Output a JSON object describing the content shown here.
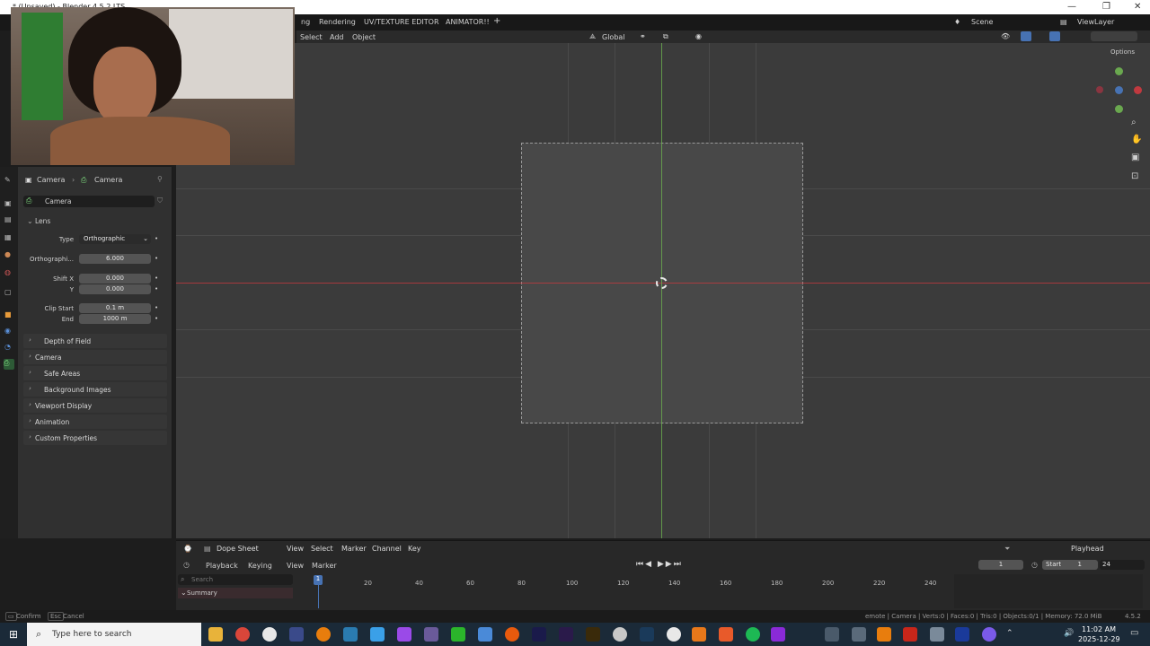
{
  "window": {
    "title": "* (Unsaved) - Blender 4.5.2 LTS"
  },
  "topbar": {
    "workspaces": [
      "Rendering",
      "UV/TEXTURE EDITOR",
      "ANIMATOR!!",
      "+"
    ],
    "scene": "Scene",
    "view_layer": "ViewLayer"
  },
  "viewport_header": {
    "menu": [
      "Select",
      "Add",
      "Object"
    ],
    "orientation": "Global",
    "options": "Options"
  },
  "properties": {
    "breadcrumb": [
      "Camera",
      "Camera"
    ],
    "datablock": "Camera",
    "lens_label": "Lens",
    "fields": [
      {
        "label": "Type",
        "value": "Orthographic"
      },
      {
        "label": "Orthographi...",
        "value": "6.000"
      },
      {
        "label": "Shift X",
        "value": "0.000"
      },
      {
        "label": "Y",
        "value": "0.000"
      },
      {
        "label": "Clip Start",
        "value": "0.1 m"
      },
      {
        "label": "End",
        "value": "1000 m"
      }
    ],
    "panels": [
      "Depth of Field",
      "Camera",
      "Safe Areas",
      "Background Images",
      "Viewport Display",
      "Animation",
      "Custom Properties"
    ]
  },
  "dopesheet": {
    "editor": "Dope Sheet",
    "menu": [
      "View",
      "Select",
      "Marker",
      "Channel",
      "Key"
    ],
    "playhead": "Playhead",
    "timeline_menu": [
      "Playback",
      "Keying",
      "View",
      "Marker"
    ],
    "current_frame": "1",
    "start_label": "Start",
    "start": "1",
    "end": "24",
    "search_placeholder": "Search",
    "summary": "Summary",
    "ticks": [
      "1",
      "20",
      "40",
      "60",
      "80",
      "100",
      "120",
      "140",
      "160",
      "180",
      "200",
      "220",
      "240"
    ]
  },
  "status": {
    "left": [
      "Confirm",
      "Esc",
      "Cancel"
    ],
    "right": "emote | Camera | Verts:0 | Faces:0 | Tris:0 | Objects:0/1 | Memory: 72.0 MiB",
    "version": "4.5.2"
  },
  "taskbar": {
    "search_placeholder": "Type here to search",
    "time": "11:02 AM",
    "date": "2025-12-29"
  },
  "colors": {
    "x_axis": "#c0393f",
    "y_axis": "#6aa84f",
    "accent": "#4772b3"
  }
}
